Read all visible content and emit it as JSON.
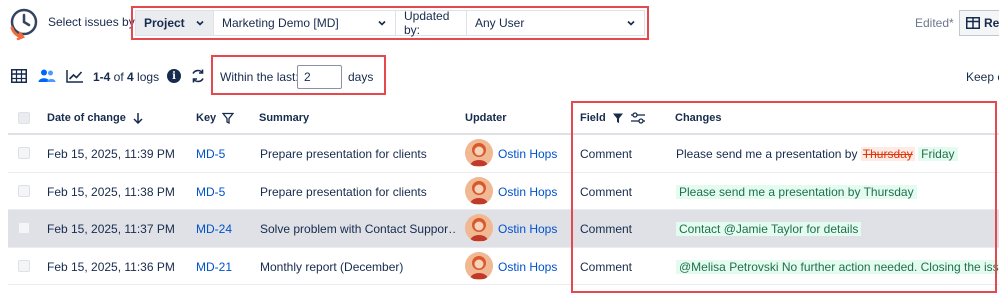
{
  "toolbar": {
    "select_label": "Select issues by:",
    "scope": "Project",
    "project": "Marketing Demo [MD]",
    "updated_by_label": "Updated by:",
    "updated_by": "Any User",
    "edited": "Edited*",
    "report_label": "Re"
  },
  "subbar": {
    "logs_prefix": "1-4",
    "logs_of": " of ",
    "logs_total": "4",
    "logs_suffix": " logs",
    "within_label": "Within the last:",
    "within_value": "2",
    "days_label": "days",
    "keep_label": "Keep c"
  },
  "table": {
    "columns": {
      "date": "Date of change",
      "key": "Key",
      "summary": "Summary",
      "updater": "Updater",
      "field": "Field",
      "changes": "Changes"
    },
    "rows": [
      {
        "date": "Feb 15, 2025, 11:39 PM",
        "key": "MD-5",
        "summary": "Prepare presentation for clients",
        "updater": "Ostin Hops",
        "field": "Comment",
        "change_text": "Please send me a presentation by ",
        "change_removed": "Thursday",
        "change_added": "Friday"
      },
      {
        "date": "Feb 15, 2025, 11:38 PM",
        "key": "MD-5",
        "summary": "Prepare presentation for clients",
        "updater": "Ostin Hops",
        "field": "Comment",
        "change_added": "Please send me a presentation by Thursday"
      },
      {
        "date": "Feb 15, 2025, 11:37 PM",
        "key": "MD-24",
        "summary": "Solve problem with Contact Suppor…",
        "updater": "Ostin Hops",
        "field": "Comment",
        "change_added": "Contact @Jamie Taylor for details"
      },
      {
        "date": "Feb 15, 2025, 11:36 PM",
        "key": "MD-21",
        "summary": "Monthly report (December)",
        "updater": "Ostin Hops",
        "field": "Comment",
        "change_added": "@Melisa Petrovski No further action needed. Closing the issue"
      }
    ]
  },
  "colors": {
    "accent_red": "#e5484d",
    "link_blue": "#0052cc",
    "added_green": "#216e4e",
    "removed_red": "#de350b"
  }
}
